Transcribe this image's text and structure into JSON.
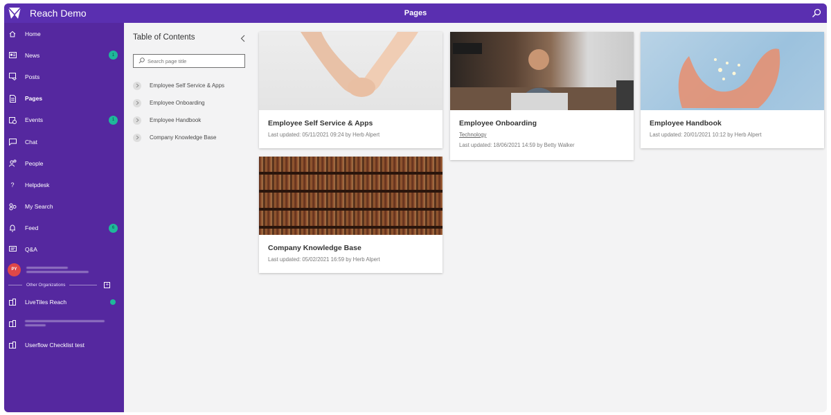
{
  "header": {
    "app_title": "Reach Demo",
    "page_title": "Pages",
    "brand_color": "#5a2fb0"
  },
  "sidebar": {
    "items": [
      {
        "label": "Home",
        "icon": "home-icon",
        "badge": null,
        "active": false
      },
      {
        "label": "News",
        "icon": "news-icon",
        "badge": "1",
        "active": false
      },
      {
        "label": "Posts",
        "icon": "posts-icon",
        "badge": null,
        "active": false
      },
      {
        "label": "Pages",
        "icon": "pages-icon",
        "badge": null,
        "active": true
      },
      {
        "label": "Events",
        "icon": "events-icon",
        "badge": "1",
        "active": false
      },
      {
        "label": "Chat",
        "icon": "chat-icon",
        "badge": null,
        "active": false
      },
      {
        "label": "People",
        "icon": "people-icon",
        "badge": null,
        "active": false
      },
      {
        "label": "Helpdesk",
        "icon": "help-icon",
        "badge": null,
        "active": false
      },
      {
        "label": "My Search",
        "icon": "my-search-icon",
        "badge": null,
        "active": false
      },
      {
        "label": "Feed",
        "icon": "bell-icon",
        "badge": "6",
        "active": false
      },
      {
        "label": "Q&A",
        "icon": "qa-icon",
        "badge": null,
        "active": false
      }
    ],
    "user": {
      "initials": "PY"
    },
    "other_orgs_label": "Other Organizations",
    "orgs": [
      {
        "label": "LiveTiles Reach",
        "status_dot": true
      },
      {
        "label": "",
        "status_dot": false
      },
      {
        "label": "Userflow Checklist test",
        "status_dot": false
      }
    ]
  },
  "toc": {
    "title": "Table of Contents",
    "search_placeholder": "Search page title",
    "items": [
      "Employee Self Service & Apps",
      "Employee Onboarding",
      "Employee Handbook",
      "Company Knowledge Base"
    ]
  },
  "cards": [
    {
      "title": "Employee Self Service & Apps",
      "tag": null,
      "meta": "Last updated: 05/11/2021 09:24 by Herb Alpert"
    },
    {
      "title": "Employee Onboarding",
      "tag": "Technology",
      "meta": "Last updated: 18/06/2021 14:59 by Betty Walker"
    },
    {
      "title": "Employee Handbook",
      "tag": null,
      "meta": "Last updated: 20/01/2021 10:12 by Herb Alpert"
    },
    {
      "title": "Company Knowledge Base",
      "tag": null,
      "meta": "Last updated: 05/02/2021 16:59 by Herb Alpert"
    }
  ]
}
